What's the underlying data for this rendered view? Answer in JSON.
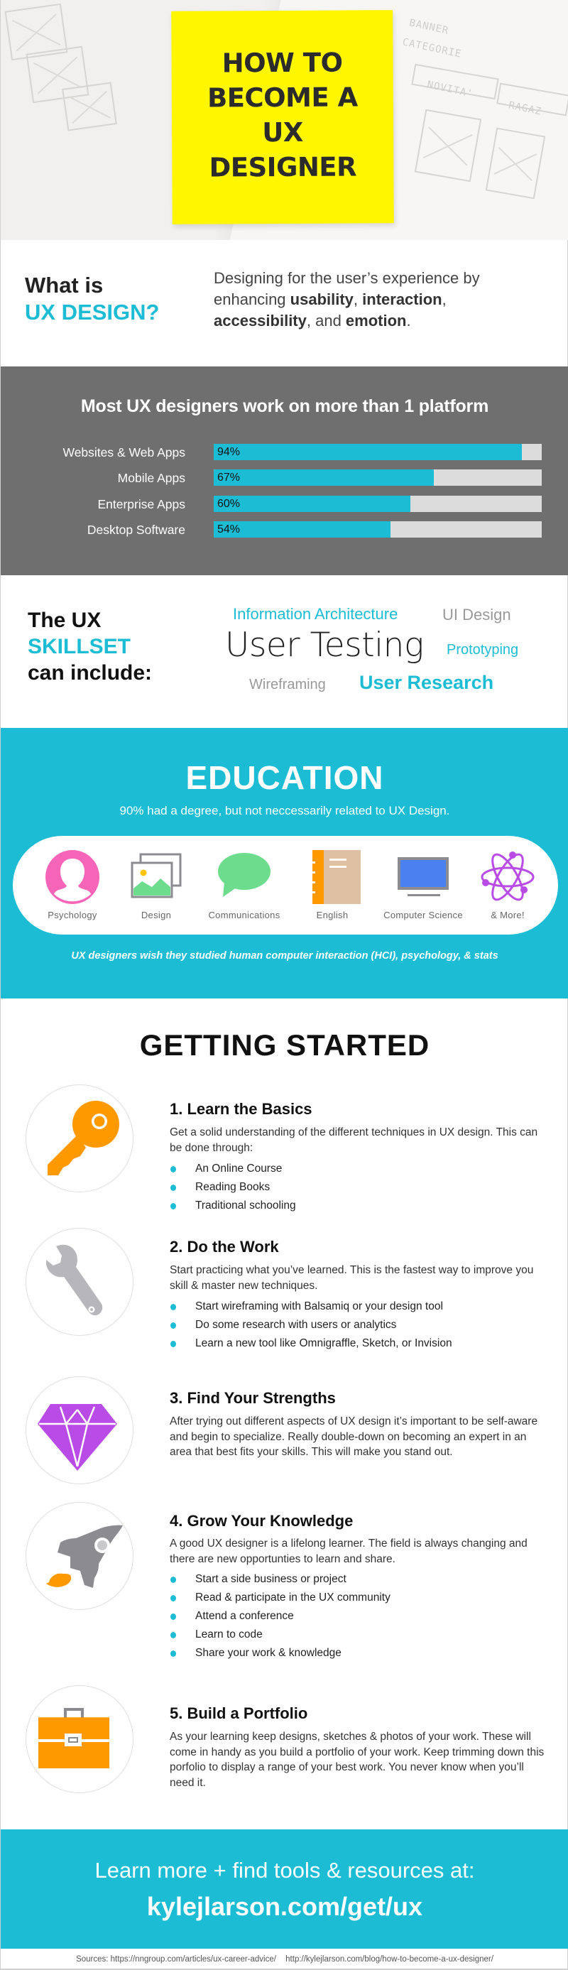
{
  "hero": {
    "title_lines": [
      "HOW TO",
      "BECOME A",
      "UX",
      "DESIGNER"
    ],
    "background_scrawls": [
      "BANNER",
      "CATEGORIE",
      "NOVITA'",
      "RAGAZ"
    ]
  },
  "what_is": {
    "question_line1": "What is",
    "question_line2": "UX DESIGN?",
    "desc_pre": "Designing for the user’s experience by enhancing ",
    "bold1": "usability",
    "sep1": ", ",
    "bold2": "interaction",
    "sep2": ", ",
    "bold3": "accessibility",
    "sep3": ", and ",
    "bold4": "emotion",
    "desc_post": "."
  },
  "platforms": {
    "title": "Most UX designers work on more than 1 platform",
    "rows": [
      {
        "label": "Websites & Web Apps",
        "value": 94,
        "display": "94%"
      },
      {
        "label": "Mobile Apps",
        "value": 67,
        "display": "67%"
      },
      {
        "label": "Enterprise Apps",
        "value": 60,
        "display": "60%"
      },
      {
        "label": "Desktop Software",
        "value": 54,
        "display": "54%"
      }
    ]
  },
  "chart_data": {
    "type": "bar",
    "orientation": "horizontal",
    "title": "Most UX designers work on more than 1 platform",
    "categories": [
      "Websites & Web Apps",
      "Mobile Apps",
      "Enterprise Apps",
      "Desktop Software"
    ],
    "values": [
      94,
      67,
      60,
      54
    ],
    "unit": "%",
    "xlim": [
      0,
      100
    ],
    "data_labels": [
      "94%",
      "67%",
      "60%",
      "54%"
    ],
    "grid": false,
    "legend": "none"
  },
  "skillset": {
    "line1": "The UX",
    "line2": "SKILLSET",
    "line3": "can include:",
    "words": {
      "information_architecture": "Information Architecture",
      "ui_design": "UI Design",
      "user_testing": "User Testing",
      "prototyping": "Prototyping",
      "wireframing": "Wireframing",
      "user_research": "User Research"
    }
  },
  "education": {
    "title": "EDUCATION",
    "subtitle": "90% had a degree, but not neccessarily related to UX Design.",
    "subjects": [
      {
        "name": "Psychology",
        "icon": "person-icon",
        "color": "#f765b8"
      },
      {
        "name": "Design",
        "icon": "image-icon",
        "color": "#6ddc8c"
      },
      {
        "name": "Communications",
        "icon": "speech-bubble-icon",
        "color": "#6ddc8c"
      },
      {
        "name": "English",
        "icon": "notebook-icon",
        "color": "#ff9900"
      },
      {
        "name": "Computer Science",
        "icon": "monitor-icon",
        "color": "#4a80f0"
      },
      {
        "name": "& More!",
        "icon": "atom-icon",
        "color": "#b94be6"
      }
    ],
    "footnote": "UX designers wish they studied human computer interaction (HCI), psychology, & stats"
  },
  "getting_started": {
    "title": "GETTING STARTED",
    "steps": [
      {
        "title": "1. Learn the Basics",
        "icon": "key-icon",
        "text": "Get a solid understanding of the different techniques in UX design. This can be done through:",
        "bullets": [
          "An Online Course",
          "Reading Books",
          "Traditional schooling"
        ]
      },
      {
        "title": "2. Do the Work",
        "icon": "wrench-icon",
        "text": "Start practicing what you’ve learned. This is the fastest way to improve you skill & master new techniques.",
        "bullets": [
          "Start wireframing with Balsamiq or your design tool",
          "Do some research with users or analytics",
          "Learn a new tool like Omnigraffle, Sketch, or Invision"
        ]
      },
      {
        "title": "3. Find Your Strengths",
        "icon": "diamond-icon",
        "text": "After trying out different aspects of UX design it’s important to be self-aware and begin to specialize. Really double-down on becoming an expert in an area that best fits your skills. This will make you stand out.",
        "bullets": []
      },
      {
        "title": "4. Grow Your Knowledge",
        "icon": "rocket-icon",
        "text": "A good UX designer is a lifelong learner. The field is always changing and there are new opportunties to learn and share.",
        "bullets": [
          "Start a side business or project",
          "Read & participate in the UX community",
          "Attend a conference",
          "Learn to code",
          "Share your work & knowledge"
        ]
      },
      {
        "title": "5. Build a Portfolio",
        "icon": "briefcase-icon",
        "text": "As your learning keep designs, sketches & photos of your work. These will come in handy as you build a portfolio of your work. Keep trimming down this porfolio to display a range of your best work. You never know when you’ll need it.",
        "bullets": []
      }
    ]
  },
  "cta": {
    "line1": "Learn more + find tools & resources at:",
    "link": "kylejlarson.com/get/ux"
  },
  "sources": {
    "label": "Sources: https://nngroup.com/articles/ux-career-advice/",
    "second": "http://kylejlarson.com/blog/how-to-become-a-ux-designer/"
  },
  "colors": {
    "accent": "#1bbcd4",
    "note_yellow": "#fff600",
    "chart_bg": "#6f6f6f",
    "bar_track": "#dcdcdc",
    "orange": "#ff9900",
    "purple": "#b94be6",
    "gray_icon": "#8c8c90"
  }
}
